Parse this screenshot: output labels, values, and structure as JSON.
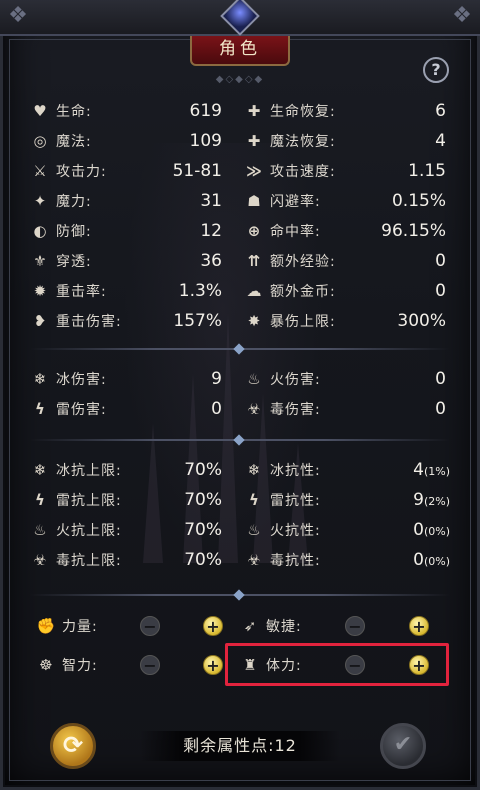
{
  "title": "角色",
  "help_icon": "?",
  "colors": {
    "highlight_border": "#e2233d",
    "title_plate": "#7a1318",
    "plus_button": "#d9b930"
  },
  "main_stats": [
    {
      "icon": "heart-icon",
      "glyph": "♥",
      "label": "生命:",
      "value": "619"
    },
    {
      "icon": "life-regen-icon",
      "glyph": "✚",
      "label": "生命恢复:",
      "value": "6"
    },
    {
      "icon": "magic-icon",
      "glyph": "◎",
      "label": "魔法:",
      "value": "109"
    },
    {
      "icon": "mana-regen-icon",
      "glyph": "✚",
      "label": "魔法恢复:",
      "value": "4"
    },
    {
      "icon": "attack-icon",
      "glyph": "⚔",
      "label": "攻击力:",
      "value": "51-81"
    },
    {
      "icon": "attack-speed-icon",
      "glyph": "≫",
      "label": "攻击速度:",
      "value": "1.15"
    },
    {
      "icon": "magic-power-icon",
      "glyph": "✦",
      "label": "魔力:",
      "value": "31"
    },
    {
      "icon": "dodge-icon",
      "glyph": "☗",
      "label": "闪避率:",
      "value": "0.15%"
    },
    {
      "icon": "shield-icon",
      "glyph": "◐",
      "label": "防御:",
      "value": "12"
    },
    {
      "icon": "crosshair-icon",
      "glyph": "⊕",
      "label": "命中率:",
      "value": "96.15%"
    },
    {
      "icon": "pierce-icon",
      "glyph": "⚜",
      "label": "穿透:",
      "value": "36"
    },
    {
      "icon": "exp-icon",
      "glyph": "⇈",
      "label": "额外经验:",
      "value": "0"
    },
    {
      "icon": "crit-rate-icon",
      "glyph": "✹",
      "label": "重击率:",
      "value": "1.3%"
    },
    {
      "icon": "gold-icon",
      "glyph": "☁",
      "label": "额外金币:",
      "value": "0"
    },
    {
      "icon": "crit-damage-icon",
      "glyph": "❥",
      "label": "重击伤害:",
      "value": "157%"
    },
    {
      "icon": "crit-cap-icon",
      "glyph": "✸",
      "label": "暴伤上限:",
      "value": "300%"
    }
  ],
  "element_damage": [
    {
      "icon": "ice-icon",
      "glyph": "❄",
      "label": "冰伤害:",
      "value": "9"
    },
    {
      "icon": "fire-icon",
      "glyph": "♨",
      "label": "火伤害:",
      "value": "0"
    },
    {
      "icon": "lightning-icon",
      "glyph": "ϟ",
      "label": "雷伤害:",
      "value": "0"
    },
    {
      "icon": "poison-icon",
      "glyph": "☣",
      "label": "毒伤害:",
      "value": "0"
    }
  ],
  "resistances": [
    {
      "icon": "ice-cap-icon",
      "glyph": "❄",
      "label": "冰抗上限:",
      "value": "70%"
    },
    {
      "icon": "ice-resist-icon",
      "glyph": "❄",
      "label": "冰抗性:",
      "value": "4",
      "sub": "(1%)"
    },
    {
      "icon": "lightning-cap-icon",
      "glyph": "ϟ",
      "label": "雷抗上限:",
      "value": "70%"
    },
    {
      "icon": "lightning-resist-icon",
      "glyph": "ϟ",
      "label": "雷抗性:",
      "value": "9",
      "sub": "(2%)"
    },
    {
      "icon": "fire-cap-icon",
      "glyph": "♨",
      "label": "火抗上限:",
      "value": "70%"
    },
    {
      "icon": "fire-resist-icon",
      "glyph": "♨",
      "label": "火抗性:",
      "value": "0",
      "sub": "(0%)"
    },
    {
      "icon": "poison-cap-icon",
      "glyph": "☣",
      "label": "毒抗上限:",
      "value": "70%"
    },
    {
      "icon": "poison-resist-icon",
      "glyph": "☣",
      "label": "毒抗性:",
      "value": "0",
      "sub": "(0%)"
    }
  ],
  "attributes": [
    {
      "icon": "strength-icon",
      "glyph": "✊",
      "label": "力量:",
      "minus": "−",
      "plus": "+"
    },
    {
      "icon": "agility-icon",
      "glyph": "➶",
      "label": "敏捷:",
      "minus": "−",
      "plus": "+"
    },
    {
      "icon": "intellect-icon",
      "glyph": "☸",
      "label": "智力:",
      "minus": "−",
      "plus": "+"
    },
    {
      "icon": "stamina-icon",
      "glyph": "♜",
      "label": "体力:",
      "minus": "−",
      "plus": "+"
    }
  ],
  "remaining_points": "剩余属性点:12",
  "reset_icon": "⟳",
  "confirm_icon": "✔"
}
